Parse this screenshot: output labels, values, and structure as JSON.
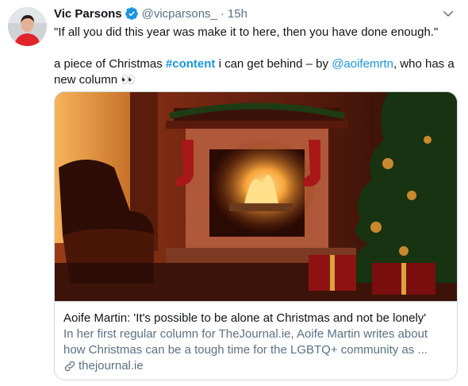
{
  "tweet": {
    "author_name": "Vic Parsons",
    "handle": "@vicparsons_",
    "separator": "·",
    "time": "15h",
    "quote": "\"If all you did this year was make it to here, then you have done enough.\"",
    "text_before_hashtag": "a piece of Christmas ",
    "hashtag": "#content",
    "text_middle": " i can get behind – by ",
    "mention": "@aoifemrtn",
    "text_after_mention": ", who has a new column ",
    "emoji": "👀"
  },
  "icons": {
    "verified": "verified-badge-icon",
    "more": "chevron-down-icon",
    "link": "link-icon"
  },
  "card": {
    "title": "Aoife Martin: 'It's possible to be alone at Christmas and not be lonely'",
    "description": "In her first regular column for TheJournal.ie, Aoife Martin writes about how Christmas can be a tough time for the LGBTQ+ community as ...",
    "domain": "thejournal.ie",
    "image_alt": "fireplace-christmas-tree-image"
  },
  "colors": {
    "accent": "#1b95e0",
    "text": "#0f1419",
    "secondary": "#5b7083",
    "border": "#cfd9de"
  }
}
